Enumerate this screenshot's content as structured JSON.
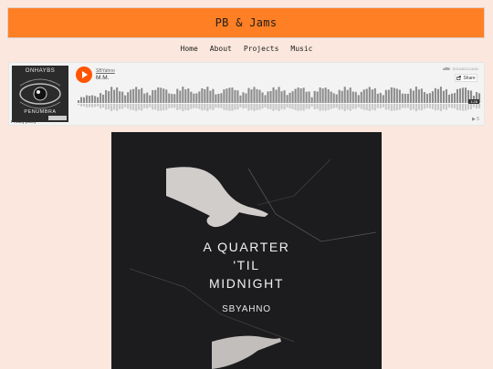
{
  "site": {
    "title": "PB & Jams"
  },
  "nav": [
    {
      "label": "Home"
    },
    {
      "label": "About"
    },
    {
      "label": "Projects"
    },
    {
      "label": "Music"
    }
  ],
  "player": {
    "artist": "SBYahno",
    "track": "M.M.",
    "share_label": "Share",
    "soundcloud_label": "SOUNDCLOUD",
    "duration": "1:28",
    "plays": "5",
    "privacy": "Privacy policy",
    "cover": {
      "top_text": "ONHAYBS",
      "bottom_text": "PENUMBRA"
    }
  },
  "artwork": {
    "title_lines": [
      "A QUARTER",
      "'TIL",
      "MIDNIGHT"
    ],
    "artist": "SBYAHNO"
  },
  "colors": {
    "background": "#fbe7dd",
    "header": "#ff7f24",
    "play_button": "#ff5500"
  }
}
